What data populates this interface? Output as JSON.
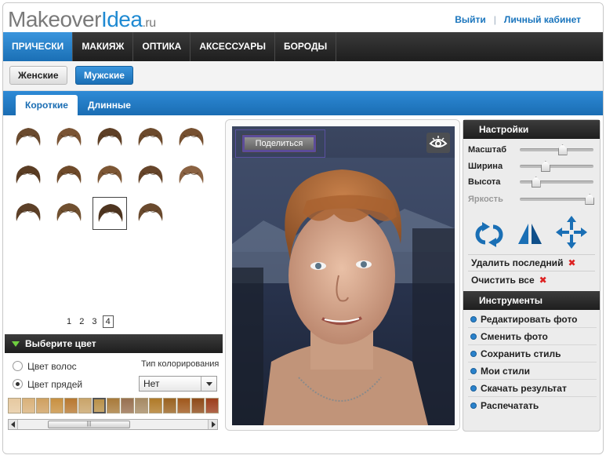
{
  "header": {
    "logo_main": "Makeover",
    "logo_accent": "Idea",
    "logo_suffix": ".ru",
    "logout": "Выйти",
    "cabinet": "Личный кабинет"
  },
  "nav": {
    "items": [
      "ПРИЧЕСКИ",
      "МАКИЯЖ",
      "ОПТИКА",
      "АКСЕССУАРЫ",
      "БОРОДЫ"
    ],
    "active_index": 0
  },
  "gender": {
    "female": "Женские",
    "male": "Мужские",
    "active": "male"
  },
  "length_tabs": {
    "short": "Короткие",
    "long": "Длинные",
    "active": "short"
  },
  "hairstyles": {
    "count": 14,
    "selected_index": 12,
    "colors": [
      "#6a4a2e",
      "#7a5434",
      "#5e3f25",
      "#6c4a2c",
      "#765030",
      "#5a3d24",
      "#6e4a2a",
      "#7c5634",
      "#66452a",
      "#8a6242",
      "#5d4028",
      "#705030",
      "#4e3520",
      "#6a4a2e"
    ]
  },
  "pagination": {
    "pages": [
      "1",
      "2",
      "3",
      "4"
    ],
    "current": "4"
  },
  "color_panel": {
    "title": "Выберите цвет",
    "option_hair": "Цвет волос",
    "option_strands": "Цвет прядей",
    "selected_option": "strands",
    "coloring_type_label": "Тип колорирования",
    "coloring_type_value": "Нет",
    "swatches": [
      "#e6c9a0",
      "#d9b17a",
      "#cfa060",
      "#c89040",
      "#b87830",
      "#c9a46a",
      "#b89048",
      "#a87a3a",
      "#987050",
      "#a58a64",
      "#b07a28",
      "#9a6220",
      "#a0581c",
      "#8e4a18",
      "#9c3e1c",
      "#a5441e",
      "#8a3418",
      "#b0502a",
      "#c2582c",
      "#a83a22",
      "#932e1c",
      "#a53520",
      "#b24628"
    ],
    "selected_swatch": 6
  },
  "photo": {
    "share_label": "Поделиться",
    "eye_icon": "eye-icon"
  },
  "settings": {
    "title": "Настройки",
    "sliders": [
      {
        "label": "Масштаб",
        "value": 0.58,
        "enabled": true
      },
      {
        "label": "Ширина",
        "value": 0.35,
        "enabled": true
      },
      {
        "label": "Высота",
        "value": 0.22,
        "enabled": true
      },
      {
        "label": "Яркость",
        "value": 0.95,
        "enabled": false
      }
    ],
    "delete_last": "Удалить последний",
    "clear_all": "Очистить все"
  },
  "tools": {
    "title": "Инструменты",
    "items": [
      "Редактировать фото",
      "Сменить фото",
      "Сохранить стиль",
      "Мои стили",
      "Скачать результат",
      "Распечатать"
    ]
  }
}
